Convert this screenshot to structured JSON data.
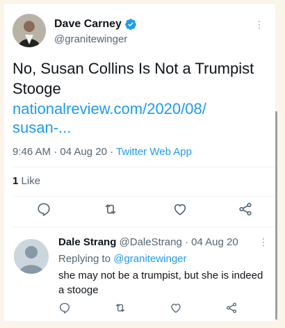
{
  "main_tweet": {
    "display_name": "Dave Carney",
    "handle": "@granitewinger",
    "text": "No, Susan Collins Is Not a Trumpist Stooge",
    "link_line1": "nationalreview.com/2020/08/",
    "link_line2": "susan-...",
    "time": "9:46 AM",
    "date": "04 Aug 20",
    "source": "Twitter Web App",
    "like_count": "1",
    "like_label": "Like",
    "more_icon": "more-icon"
  },
  "reply": {
    "display_name": "Dale Strang",
    "handle": "@DaleStrang",
    "date": "04 Aug 20",
    "replying_to_label": "Replying to",
    "replying_to_handle": "@granitewinger",
    "text": "she may not be a trumpist, but she is indeed a stooge"
  },
  "colors": {
    "accent": "#1d9bf0",
    "secondary_text": "#536471",
    "background": "#fbf4e8"
  }
}
